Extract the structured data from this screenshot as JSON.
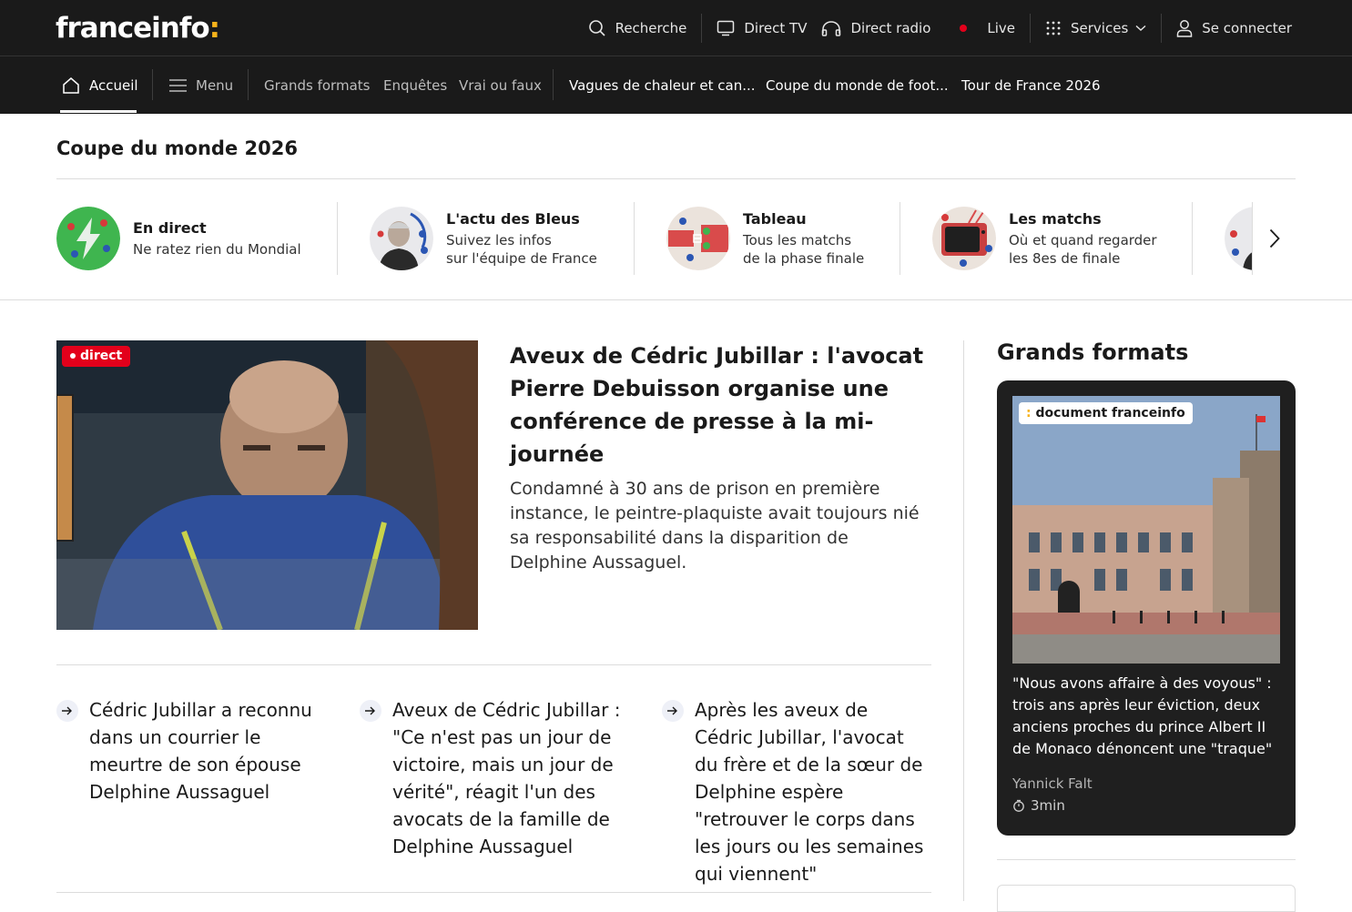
{
  "header": {
    "logo": "franceinfo",
    "logo_colon": ":",
    "search": "Recherche",
    "direct_tv": "Direct TV",
    "direct_radio": "Direct radio",
    "live": "Live",
    "services": "Services",
    "login": "Se connecter"
  },
  "subnav": {
    "home": "Accueil",
    "menu": "Menu",
    "links": [
      "Grands formats",
      "Enquêtes",
      "Vrai ou faux"
    ],
    "topics": [
      "Vagues de chaleur et can...",
      "Coupe du monde de foot...",
      "Tour de France 2026"
    ]
  },
  "cdm": {
    "title": "Coupe du monde 2026",
    "cards": [
      {
        "title": "En direct",
        "sub1": "Ne ratez rien du Mondial",
        "sub2": ""
      },
      {
        "title": "L'actu des Bleus",
        "sub1": "Suivez les infos",
        "sub2": "sur l'équipe de France"
      },
      {
        "title": "Tableau",
        "sub1": "Tous les matchs",
        "sub2": "de la phase finale"
      },
      {
        "title": "Les matchs",
        "sub1": "Où et quand regarder",
        "sub2": "les 8es de finale"
      }
    ]
  },
  "main": {
    "badge": "direct",
    "headline": "Aveux de Cédric Jubillar : l'avocat Pierre Debuisson organise une conférence de presse à la mi-journée",
    "chapo": "Condamné à 30 ans de prison en première instance, le peintre-plaquiste avait toujours nié sa responsabilité dans la disparition de Delphine Aussaguel.",
    "related": [
      "Cédric Jubillar a reconnu dans un courrier le meurtre de son épouse Delphine Aussaguel",
      "Aveux de Cédric Jubillar : \"Ce n'est pas un jour de victoire, mais un jour de vérité\", réagit l'un des avocats de la famille de Delphine Aussaguel",
      "Après les aveux de Cédric Jubillar, l'avocat du frère et de la sœur de Delphine espère \"retrouver le corps dans les jours ou les semaines qui viennent\""
    ]
  },
  "grands_formats": {
    "title": "Grands formats",
    "badge_colon": ":",
    "badge": "document franceinfo",
    "text": "\"Nous avons affaire à des voyous\" : trois ans après leur éviction, deux anciens proches du prince Albert II de Monaco dénoncent une \"traque\"",
    "author": "Yannick Falt",
    "duration": "3min"
  },
  "colors": {
    "dark": "#1a1a1a",
    "accent": "#f7b31b",
    "live_red": "#e3001b"
  }
}
